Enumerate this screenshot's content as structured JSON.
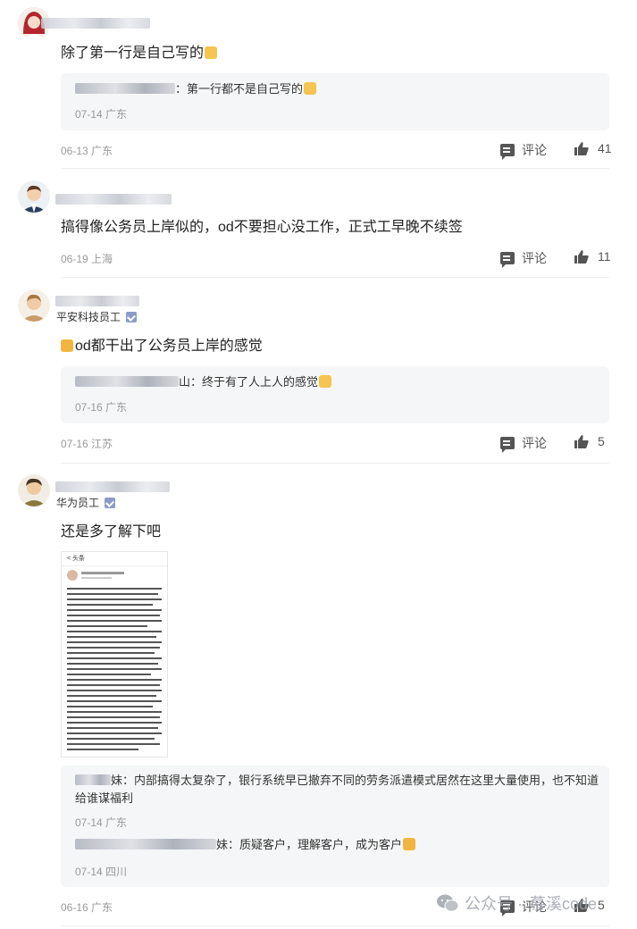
{
  "comments": [
    {
      "content": "除了第一行是自己写的",
      "reply": {
        "text": "：第一行都不是自己写的",
        "meta": "07-14 广东"
      },
      "meta": "06-13 广东",
      "comment_label": "评论",
      "likes": "41"
    },
    {
      "content": "搞得像公务员上岸似的，od不要担心没工作，正式工早晚不续签",
      "meta": "06-19 上海",
      "comment_label": "评论",
      "likes": "11"
    },
    {
      "badge": "平安科技员工",
      "content": "od都干出了公务员上岸的感觉",
      "reply": {
        "text": "山：终于有了人上人的感觉",
        "meta": "07-16 广东"
      },
      "meta": "07-16 江苏",
      "comment_label": "评论",
      "likes": "5"
    },
    {
      "badge": "华为员工",
      "content": "还是多了解下吧",
      "replies": [
        {
          "text": "妹：内部搞得太复杂了，银行系统早已撤弃不同的劳务派遣模式居然在这里大量使用，也不知道给谁谋福利",
          "meta": "07-14 广东"
        },
        {
          "text": "妹：质疑客户，理解客户，成为客户",
          "meta": "07-14 四川"
        }
      ],
      "meta": "06-16 广东",
      "comment_label": "评论",
      "likes": "5"
    }
  ],
  "thumbnail": {
    "header": "< 头条"
  },
  "watermark": {
    "prefix": "公众号 ·",
    "name": "慕溪code"
  },
  "colors": {
    "meta": "#999999",
    "reply_bg": "#f5f6f7",
    "verify": "#8c9cc8"
  }
}
